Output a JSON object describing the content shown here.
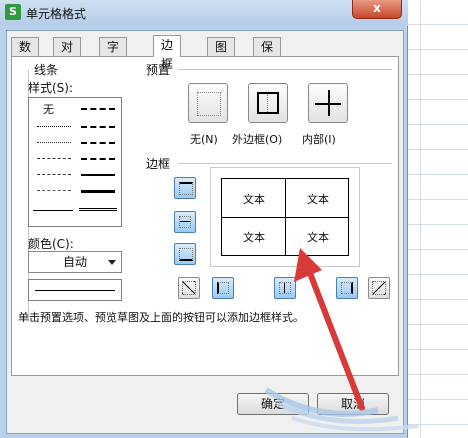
{
  "window": {
    "icon_label": "S",
    "title": "单元格格式",
    "close_label": "x"
  },
  "tabs": [
    {
      "label": "数字"
    },
    {
      "label": "对齐"
    },
    {
      "label": "字体"
    },
    {
      "label": "边框",
      "active": true
    },
    {
      "label": "图案"
    },
    {
      "label": "保护"
    }
  ],
  "line_section": {
    "heading": "线条",
    "style_label": "样式(S):",
    "none_label": "无",
    "color_label": "颜色(C):",
    "color_value": "自动"
  },
  "presets": {
    "heading": "预置",
    "items": [
      {
        "label": "无(N)"
      },
      {
        "label": "外边框(O)"
      },
      {
        "label": "内部(I)"
      }
    ]
  },
  "border": {
    "heading": "边框",
    "cells": [
      "文本",
      "文本",
      "文本",
      "文本"
    ]
  },
  "hint": "单击预置选项、预览草图及上面的按钮可以添加边框样式。",
  "footer": {
    "ok_label": "确定",
    "cancel_label": "取消"
  },
  "colors": {
    "accent_red": "#d83a3a",
    "selected_blue": "#9cc9f2"
  }
}
